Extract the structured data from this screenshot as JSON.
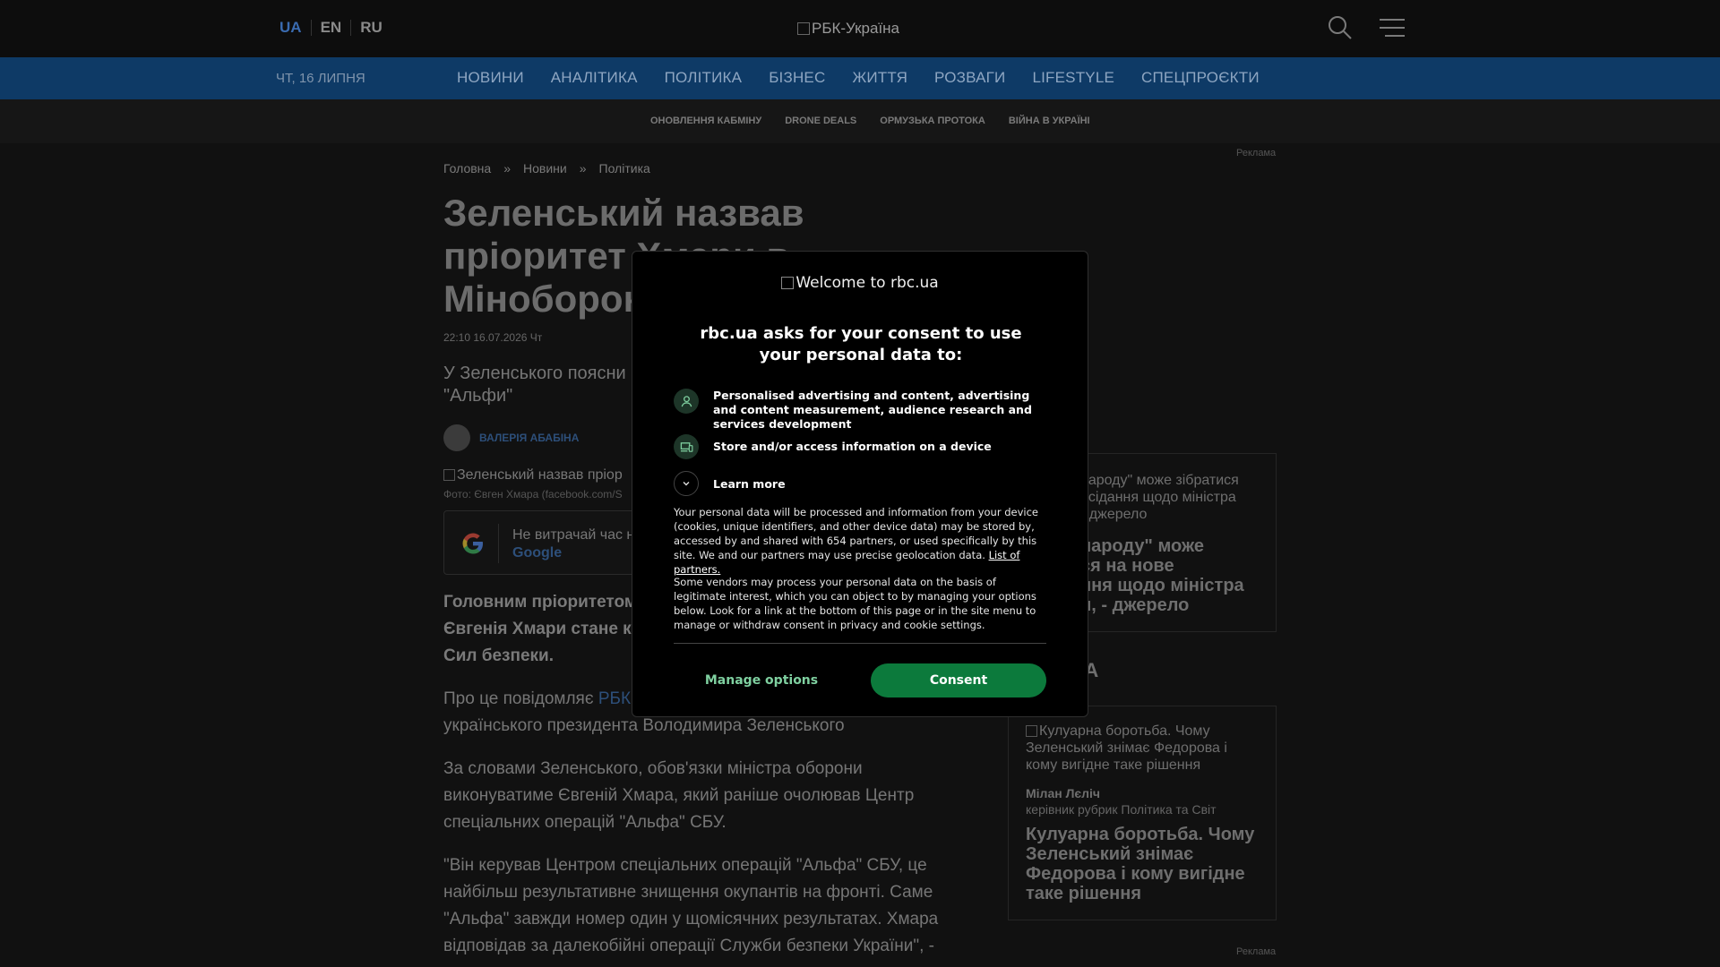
{
  "header": {
    "languages": [
      "UA",
      "EN",
      "RU"
    ],
    "logo_alt": "РБК-Україна"
  },
  "nav": {
    "date": "ЧТ, 16 ЛИПНЯ",
    "items": [
      "НОВИНИ",
      "АНАЛІТИКА",
      "ПОЛІТИКА",
      "БІЗНЕС",
      "ЖИТТЯ",
      "РОЗВАГИ",
      "LIFESTYLE",
      "СПЕЦПРОЄКТИ"
    ]
  },
  "subnav": {
    "items": [
      "ОНОВЛЕННЯ КАБМІНУ",
      "DRONE DEALS",
      "ОРМУЗЬКА ПРОТОКА",
      "ВІЙНА В УКРАЇНІ"
    ]
  },
  "ad_label": "Реклама",
  "article": {
    "breadcrumb": [
      "Головна",
      "»",
      "Новини",
      "»",
      "Політика"
    ],
    "headline_lines": [
      "Зеленський назвав",
      "пріоритет Хмари в",
      "Міноборони"
    ],
    "pubdate": "22:10 16.07.2026 Чт",
    "lead_lines": [
      "У Зеленського поясни",
      "\"Альфи\""
    ],
    "author": "ВАЛЕРІЯ АБАБІНА",
    "photo_alt": "Зеленський назвав пріор",
    "photo_credit": "Фото: Євген Хмара (facebook.com/S",
    "gnews_line1": "Не витрачай час н",
    "gnews_line2": "Google",
    "p1_lines": [
      "Головним пріоритетом",
      "Євгенія Хмари стане ко",
      "Сил безпеки."
    ],
    "p2_prefix": "Про це повідомляє",
    "p2_link": "РБК",
    "p2_line2": "українського президента Володимира Зеленського",
    "p3_lines": [
      "За словами Зеленського, обов'язки міністра оборони",
      "виконуватиме Євгеній Хмара, який раніше очолював Центр",
      "спеціальних операцій \"Альфа\" СБУ."
    ],
    "p4_lines": [
      "\"Він керував Центром спеціальних операцій \"Альфа\" СБУ, це",
      "найбільш результативне знищення окупантів на фронті. Саме",
      "\"Альфа\" завжди номер один у щомісячних результатах. Хмара",
      "відповідав за далекобійні операції Служби безпеки України\", -"
    ]
  },
  "sidebar": {
    "card1_alt_lines": [
      "народу\" може зібратися",
      "асідання щодо міністра",
      "- джерело"
    ],
    "card1_title_lines": [
      "народу\" може",
      "ся на нове",
      "ння щодо міністра",
      "и, - джерело"
    ],
    "heading": "КА",
    "card2_alt_lines": [
      "Кулуарна боротьба. Чому",
      "Зеленський знімає Федорова і",
      "кому вигідне таке рішення"
    ],
    "card2_author": "Мілан Лєліч",
    "card2_role": "керівник рубрик Політика та Світ",
    "card2_title_lines": [
      "Кулуарна боротьба. Чому",
      "Зеленський знімає",
      "Федорова і кому вигідне",
      "таке рішення"
    ]
  },
  "consent": {
    "welcome_alt": "Welcome to rbc.ua",
    "heading": "rbc.ua asks for your consent to use your personal data to:",
    "purposes": [
      "Personalised advertising and content, advertising and content measurement, audience research and services development",
      "Store and/or access information on a device"
    ],
    "learn_more": "Learn more",
    "para1": "Your personal data will be processed and information from your device (cookies, unique identifiers, and other device data) may be stored by, accessed by and shared with 654 partners, or used specifically by this site. We and our partners may use precise geolocation data.",
    "para1_link": "List of partners.",
    "para2": "Some vendors may process your personal data on the basis of legitimate interest, which you can object to by managing your options below. Look for a link at the bottom of this page or in the site menu to manage or withdraw consent in privacy and cookie settings.",
    "manage_label": "Manage options",
    "consent_label": "Consent"
  },
  "colors": {
    "nav_bg": "#0e3a66",
    "consent_button": "#0c7a3c",
    "accent_green": "#7fd0a0"
  }
}
